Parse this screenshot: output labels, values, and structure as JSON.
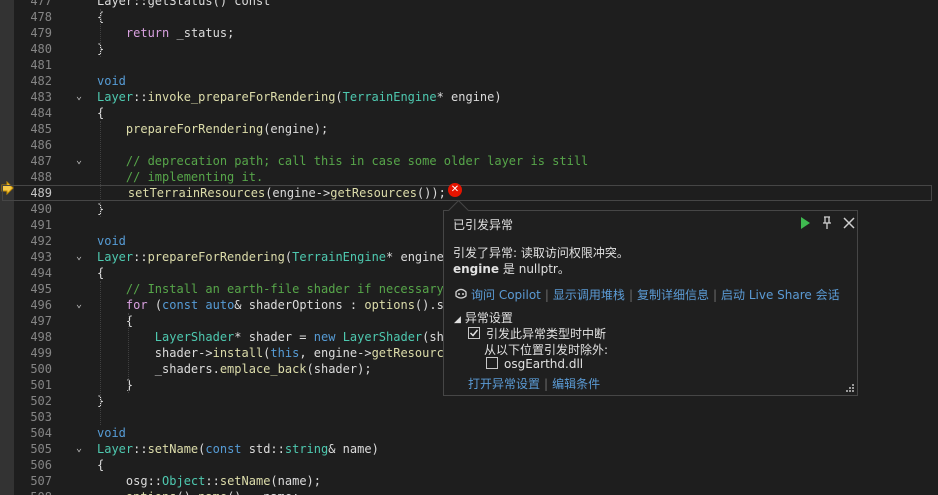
{
  "editor": {
    "lines": [
      {
        "num": "477",
        "fold": false,
        "current": false,
        "tokens": [
          {
            "t": "Layer::getStatus() const",
            "c": "tx"
          }
        ]
      },
      {
        "num": "478",
        "fold": false,
        "current": false,
        "tokens": [
          {
            "t": "{",
            "c": "tx"
          }
        ]
      },
      {
        "num": "479",
        "fold": false,
        "current": false,
        "tokens": [
          {
            "t": "    ",
            "c": "tx"
          },
          {
            "t": "return",
            "c": "ctl"
          },
          {
            "t": " _status;",
            "c": "tx"
          }
        ]
      },
      {
        "num": "480",
        "fold": false,
        "current": false,
        "tokens": [
          {
            "t": "}",
            "c": "tx"
          }
        ]
      },
      {
        "num": "481",
        "fold": false,
        "current": false,
        "tokens": []
      },
      {
        "num": "482",
        "fold": false,
        "current": false,
        "tokens": [
          {
            "t": "void",
            "c": "kw"
          }
        ]
      },
      {
        "num": "483",
        "fold": true,
        "current": false,
        "tokens": [
          {
            "t": "Layer",
            "c": "tp"
          },
          {
            "t": "::",
            "c": "tx"
          },
          {
            "t": "invoke_prepareForRendering",
            "c": "fn"
          },
          {
            "t": "(",
            "c": "tx"
          },
          {
            "t": "TerrainEngine",
            "c": "tp"
          },
          {
            "t": "* engine)",
            "c": "tx"
          }
        ]
      },
      {
        "num": "484",
        "fold": false,
        "current": false,
        "tokens": [
          {
            "t": "{",
            "c": "tx"
          }
        ]
      },
      {
        "num": "485",
        "fold": false,
        "current": false,
        "tokens": [
          {
            "t": "    ",
            "c": "tx"
          },
          {
            "t": "prepareForRendering",
            "c": "fn"
          },
          {
            "t": "(engine);",
            "c": "tx"
          }
        ]
      },
      {
        "num": "486",
        "fold": false,
        "current": false,
        "tokens": []
      },
      {
        "num": "487",
        "fold": true,
        "current": false,
        "tokens": [
          {
            "t": "    // deprecation path; call this in case some older layer is still",
            "c": "cm"
          }
        ]
      },
      {
        "num": "488",
        "fold": false,
        "current": false,
        "tokens": [
          {
            "t": "    // implementing it.",
            "c": "cm"
          }
        ]
      },
      {
        "num": "489",
        "fold": false,
        "current": true,
        "tokens": [
          {
            "t": "    ",
            "c": "tx"
          },
          {
            "t": "setTerrainResources",
            "c": "fn"
          },
          {
            "t": "(engine->",
            "c": "tx"
          },
          {
            "t": "getResources",
            "c": "fn"
          },
          {
            "t": "());",
            "c": "tx"
          }
        ]
      },
      {
        "num": "490",
        "fold": false,
        "current": false,
        "tokens": [
          {
            "t": "}",
            "c": "tx"
          }
        ]
      },
      {
        "num": "491",
        "fold": false,
        "current": false,
        "tokens": []
      },
      {
        "num": "492",
        "fold": false,
        "current": false,
        "tokens": [
          {
            "t": "void",
            "c": "kw"
          }
        ]
      },
      {
        "num": "493",
        "fold": true,
        "current": false,
        "tokens": [
          {
            "t": "Layer",
            "c": "tp"
          },
          {
            "t": "::",
            "c": "tx"
          },
          {
            "t": "prepareForRendering",
            "c": "fn"
          },
          {
            "t": "(",
            "c": "tx"
          },
          {
            "t": "TerrainEngine",
            "c": "tp"
          },
          {
            "t": "* engine)",
            "c": "tx"
          }
        ]
      },
      {
        "num": "494",
        "fold": false,
        "current": false,
        "tokens": [
          {
            "t": "{",
            "c": "tx"
          }
        ]
      },
      {
        "num": "495",
        "fold": false,
        "current": false,
        "tokens": [
          {
            "t": "    // Install an earth-file shader if necessary",
            "c": "cm"
          }
        ]
      },
      {
        "num": "496",
        "fold": true,
        "current": false,
        "tokens": [
          {
            "t": "    ",
            "c": "tx"
          },
          {
            "t": "for",
            "c": "ctl"
          },
          {
            "t": " (",
            "c": "tx"
          },
          {
            "t": "const auto",
            "c": "kw"
          },
          {
            "t": "& shaderOptions : ",
            "c": "tx"
          },
          {
            "t": "options",
            "c": "fn"
          },
          {
            "t": "().sh",
            "c": "tx"
          }
        ]
      },
      {
        "num": "497",
        "fold": false,
        "current": false,
        "tokens": [
          {
            "t": "    {",
            "c": "tx"
          }
        ]
      },
      {
        "num": "498",
        "fold": false,
        "current": false,
        "tokens": [
          {
            "t": "        ",
            "c": "tx"
          },
          {
            "t": "LayerShader",
            "c": "tp"
          },
          {
            "t": "* shader = ",
            "c": "tx"
          },
          {
            "t": "new",
            "c": "kw"
          },
          {
            "t": " ",
            "c": "tx"
          },
          {
            "t": "LayerShader",
            "c": "tp"
          },
          {
            "t": "(sha",
            "c": "tx"
          }
        ]
      },
      {
        "num": "499",
        "fold": false,
        "current": false,
        "tokens": [
          {
            "t": "        shader->",
            "c": "tx"
          },
          {
            "t": "install",
            "c": "fn"
          },
          {
            "t": "(",
            "c": "tx"
          },
          {
            "t": "this",
            "c": "kw"
          },
          {
            "t": ", engine->",
            "c": "tx"
          },
          {
            "t": "getResource",
            "c": "fn"
          }
        ]
      },
      {
        "num": "500",
        "fold": false,
        "current": false,
        "tokens": [
          {
            "t": "        _shaders.",
            "c": "tx"
          },
          {
            "t": "emplace_back",
            "c": "fn"
          },
          {
            "t": "(shader);",
            "c": "tx"
          }
        ]
      },
      {
        "num": "501",
        "fold": false,
        "current": false,
        "tokens": [
          {
            "t": "    }",
            "c": "tx"
          }
        ]
      },
      {
        "num": "502",
        "fold": false,
        "current": false,
        "tokens": [
          {
            "t": "}",
            "c": "tx"
          }
        ]
      },
      {
        "num": "503",
        "fold": false,
        "current": false,
        "tokens": []
      },
      {
        "num": "504",
        "fold": false,
        "current": false,
        "tokens": [
          {
            "t": "void",
            "c": "kw"
          }
        ]
      },
      {
        "num": "505",
        "fold": true,
        "current": false,
        "tokens": [
          {
            "t": "Layer",
            "c": "tp"
          },
          {
            "t": "::",
            "c": "tx"
          },
          {
            "t": "setName",
            "c": "fn"
          },
          {
            "t": "(",
            "c": "tx"
          },
          {
            "t": "const",
            "c": "kw"
          },
          {
            "t": " std::",
            "c": "tx"
          },
          {
            "t": "string",
            "c": "tp"
          },
          {
            "t": "& name)",
            "c": "tx"
          }
        ]
      },
      {
        "num": "506",
        "fold": false,
        "current": false,
        "tokens": [
          {
            "t": "{",
            "c": "tx"
          }
        ]
      },
      {
        "num": "507",
        "fold": false,
        "current": false,
        "tokens": [
          {
            "t": "    osg::",
            "c": "tx"
          },
          {
            "t": "Object",
            "c": "tp"
          },
          {
            "t": "::",
            "c": "tx"
          },
          {
            "t": "setName",
            "c": "fn"
          },
          {
            "t": "(name);",
            "c": "tx"
          }
        ]
      },
      {
        "num": "508",
        "fold": false,
        "current": false,
        "tokens": [
          {
            "t": "    ",
            "c": "tx"
          },
          {
            "t": "options",
            "c": "fn"
          },
          {
            "t": "().",
            "c": "tx"
          },
          {
            "t": "name",
            "c": "fn"
          },
          {
            "t": "() = name;",
            "c": "tx"
          }
        ]
      }
    ]
  },
  "popup": {
    "title": "已引发异常",
    "message_line1": "引发了异常: 读取访问权限冲突。",
    "message_bold": "engine",
    "message_rest": " 是 nullptr。",
    "links": [
      "询问 Copilot",
      "显示调用堆栈",
      "复制详细信息",
      "启动 Live Share 会话"
    ],
    "section_title": "异常设置",
    "break_option": "引发此异常类型时中断",
    "except_label": "从以下位置引发时除外:",
    "dll_option": "osgEarthd.dll",
    "bottom_links": [
      "打开异常设置",
      "编辑条件"
    ],
    "break_checked": true,
    "dll_checked": false
  },
  "colors": {
    "background": "#1e1e1e",
    "keyword": "#569cd6",
    "type": "#4ec9b0",
    "function": "#dcdcaa",
    "comment": "#57a64a",
    "control": "#d8a0df",
    "link": "#5b9bd5",
    "error": "#e51400",
    "play": "#3fb950"
  }
}
